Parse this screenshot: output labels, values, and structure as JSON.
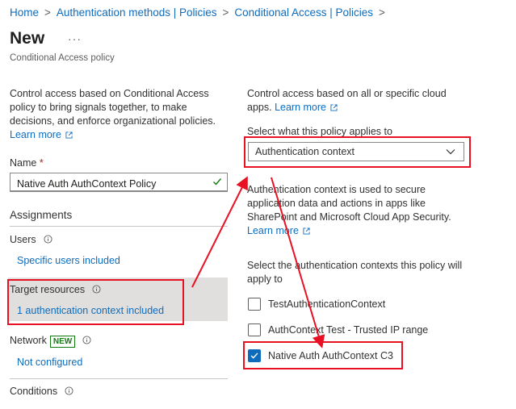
{
  "breadcrumb": {
    "items": [
      "Home",
      "Authentication methods | Policies",
      "Conditional Access | Policies"
    ]
  },
  "header": {
    "title": "New",
    "more": "···",
    "subtitle": "Conditional Access policy"
  },
  "left": {
    "description": "Control access based on Conditional Access policy to bring signals together, to make decisions, and enforce organizational policies.",
    "learn_more": "Learn more",
    "name_label": "Name",
    "name_required": "*",
    "name_value": "Native Auth AuthContext Policy",
    "assignments_label": "Assignments",
    "users": {
      "label": "Users",
      "value": "Specific users included"
    },
    "target_resources": {
      "label": "Target resources",
      "value": "1 authentication context included"
    },
    "network": {
      "label": "Network",
      "badge": "NEW",
      "value": "Not configured"
    },
    "conditions": {
      "label": "Conditions"
    }
  },
  "right": {
    "intro": "Control access based on all or specific cloud apps.",
    "learn_more": "Learn more",
    "select_label": "Select what this policy applies to",
    "select_value": "Authentication context",
    "auth_desc": "Authentication context is used to secure application data and actions in apps like SharePoint and Microsoft Cloud App Security.",
    "learn_more_2": "Learn more",
    "contexts_label": "Select the authentication contexts this policy will apply to",
    "contexts": [
      {
        "label": "TestAuthenticationContext",
        "checked": false
      },
      {
        "label": "AuthContext Test - Trusted IP range",
        "checked": false
      },
      {
        "label": "Native Auth AuthContext C3",
        "checked": true
      }
    ]
  },
  "colors": {
    "link": "#0f6cbd",
    "annotation": "#e81123",
    "checkbox_checked": "#0f6cbd",
    "badge": "#107c10",
    "selected_row": "#e1dfdd"
  }
}
